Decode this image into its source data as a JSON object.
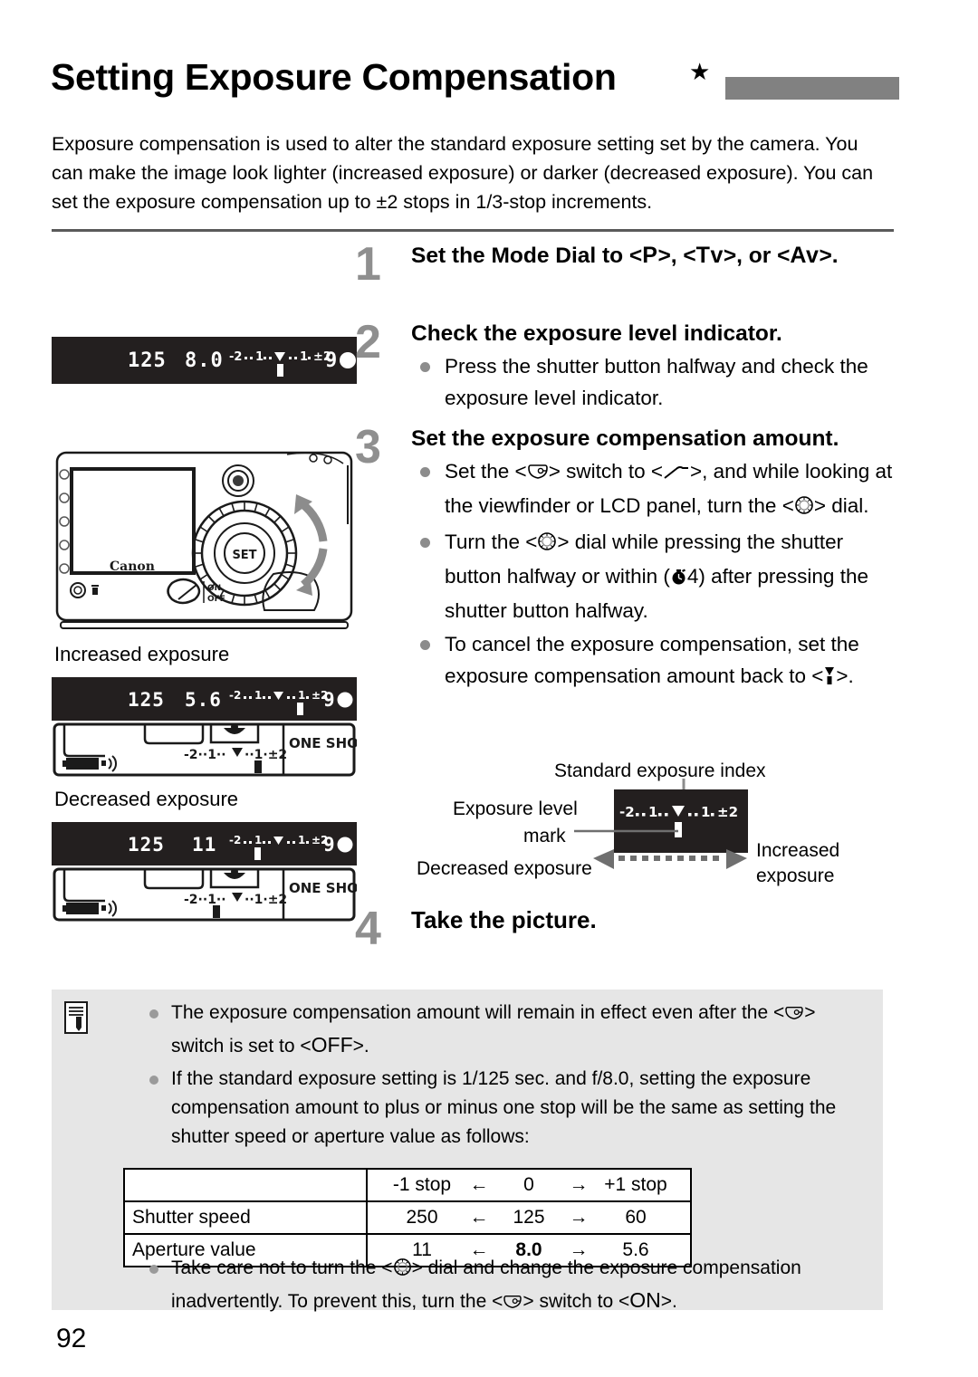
{
  "header": {
    "title": "Setting Exposure Compensation",
    "star": "★",
    "bar_color": "#818181"
  },
  "intro": "Exposure compensation is used to alter the standard exposure setting set by the camera. You can make the image look lighter (increased exposure) or darker (decreased exposure). You can set the exposure compensation up to ±2 stops in 1/3-stop increments.",
  "steps": [
    {
      "number": "1",
      "heading_part1": "Set the Mode Dial to <",
      "mode1": "P",
      "heading_part2": ">, <",
      "mode2": "Tv",
      "heading_part3": ">, or <",
      "mode3": "Av",
      "heading_part4": ">.",
      "bullets": []
    },
    {
      "number": "2",
      "heading": "Check the exposure level indicator.",
      "bullets": [
        "Press the shutter button halfway and check the exposure level indicator."
      ]
    },
    {
      "number": "3",
      "heading": "Set the exposure compensation amount.",
      "bullets": [
        {
          "a": "Set the <",
          "icon1": "quick-control-switch-icon",
          "b": "> switch to <",
          "icon2": "switch-on-slash-icon",
          "c": ">, and while looking at the viewfinder or LCD panel, turn the <",
          "icon3": "quick-control-dial-icon",
          "d": "> dial."
        },
        {
          "a": "Turn the <",
          "icon1": "quick-control-dial-icon",
          "b": "> dial while pressing the shutter button halfway or within (",
          "icon2": "timer-icon",
          "c": "4) after pressing the shutter button halfway."
        },
        {
          "a": "To cancel the exposure compensation, set the exposure compensation amount back to <",
          "icon1": "exposure-level-mark-icon",
          "b": ">."
        }
      ]
    },
    {
      "number": "4",
      "heading": "Take the picture.",
      "bullets": []
    }
  ],
  "exposure_diagram": {
    "standard_index_label": "Standard exposure index",
    "exposure_level_label_line1": "Exposure level",
    "exposure_level_label_line2": "mark",
    "decreased_label": "Decreased exposure",
    "increased_label_line1": "Increased",
    "increased_label_line2": "exposure",
    "scale_text": "-2..1..▼..1.±2"
  },
  "figures": {
    "viewfinder_standard": {
      "shutter_speed": "125",
      "aperture": "8.0",
      "scale": "-2··1··▼··1·±2",
      "shots": "9",
      "focus_dot": "●",
      "mark_position": "center"
    },
    "increased": {
      "caption": "Increased exposure",
      "viewfinder": {
        "shutter_speed": "125",
        "aperture": "5.6",
        "scale": "-2··1··▼··1·±2",
        "shots": "9",
        "focus_dot": "●",
        "mark_position": "+1"
      },
      "lcd_panel": {
        "scale": "-2··1··▼··1·±2",
        "drive_mode": "ONE SHOT",
        "battery_icon": "battery-icon",
        "beeper_icon": "beeper-icon",
        "mark_position": "+1"
      }
    },
    "decreased": {
      "caption": "Decreased exposure",
      "viewfinder": {
        "shutter_speed": "125",
        "aperture": "11",
        "scale": "-2··1··▼··1·±2",
        "shots": "9",
        "focus_dot": "●",
        "mark_position": "-1"
      },
      "lcd_panel": {
        "scale": "-2··1··▼··1·±2",
        "drive_mode": "ONE SHOT",
        "battery_icon": "battery-icon",
        "beeper_icon": "beeper-icon",
        "mark_position": "-1"
      }
    },
    "camera": {
      "brand": "Canon",
      "set_button_label": "SET",
      "switch_on_label": "ON",
      "switch_off_label": "OFF"
    }
  },
  "notes": {
    "icon": "note-pencil-icon",
    "items": [
      {
        "a": "The exposure compensation amount will remain in effect even after the <",
        "icon1": "quick-control-switch-icon",
        "b": "> switch is set to <",
        "strong": "OFF",
        "c": ">."
      },
      {
        "text": "If the standard exposure setting is 1/125 sec. and f/8.0, setting the exposure compensation amount to plus or minus one stop will be the same as setting the shutter speed or aperture value as follows:"
      },
      {
        "a": "Take care not to turn the <",
        "icon1": "quick-control-dial-icon",
        "b": "> dial and change the exposure compensation inadvertently. To prevent this, turn the <",
        "icon2": "quick-control-switch-icon",
        "c": "> switch to <",
        "strong": "ON",
        "d": ">."
      }
    ]
  },
  "table": {
    "header": {
      "label": "",
      "minus": "-1 stop",
      "left_arrow": "←",
      "center": "0",
      "right_arrow": "→",
      "plus": "+1 stop"
    },
    "rows": [
      {
        "label": "Shutter speed",
        "minus": "250",
        "left_arrow": "←",
        "center": "125",
        "right_arrow": "→",
        "plus": "60"
      },
      {
        "label": "Aperture value",
        "minus": "11",
        "left_arrow": "←",
        "center": "8.0",
        "right_arrow": "→",
        "plus": "5.6"
      }
    ]
  },
  "footer": {
    "page_number": "92"
  }
}
